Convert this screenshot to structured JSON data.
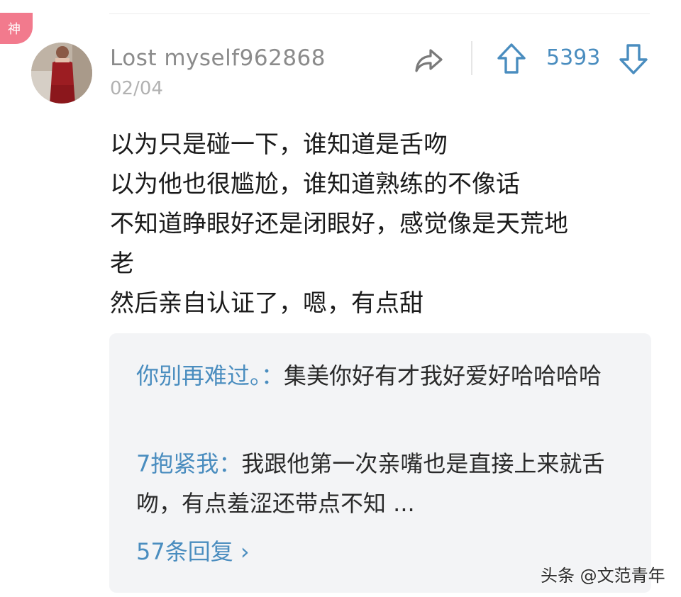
{
  "badge": {
    "label": "神"
  },
  "comment": {
    "username": "Lost   myself962868",
    "date": "02/04",
    "vote_count": "5393",
    "lines": [
      "以为只是碰一下，谁知道是舌吻",
      "以为他也很尴尬，谁知道熟练的不像话",
      "不知道睁眼好还是闭眼好，感觉像是天荒地",
      "老",
      "然后亲自认证了，嗯，有点甜"
    ]
  },
  "replies": {
    "items": [
      {
        "author": "你别再难过。",
        "separator": "：",
        "text": "集美你好有才我好爱好哈哈哈哈"
      },
      {
        "author": "7抱紧我",
        "separator": "：",
        "text": "我跟他第一次亲嘴也是直接上来就舌吻，有点羞涩还带点不知 ..."
      }
    ],
    "more_label": "57条回复 ›"
  },
  "watermark": {
    "text": "头条 @文范青年"
  },
  "colors": {
    "link_blue": "#4a8dbf",
    "badge_pink": "#f27a8d",
    "reply_bg": "#f3f4f6"
  },
  "icons": {
    "share": "share-arrow-icon",
    "upvote": "arrow-up-icon",
    "downvote": "arrow-down-icon"
  }
}
